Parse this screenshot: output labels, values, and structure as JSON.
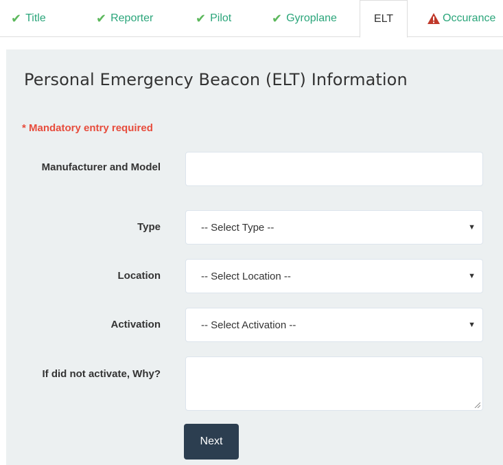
{
  "tabs": [
    {
      "label": "Title",
      "status": "done"
    },
    {
      "label": "Reporter",
      "status": "done"
    },
    {
      "label": "Pilot",
      "status": "done"
    },
    {
      "label": "Gyroplane",
      "status": "done"
    },
    {
      "label": "ELT",
      "status": "active"
    },
    {
      "label": "Occurance",
      "status": "error"
    }
  ],
  "form": {
    "heading": "Personal Emergency Beacon (ELT) Information",
    "mandatory_note": "* Mandatory entry required",
    "manufacturer": {
      "label": "Manufacturer and Model",
      "value": ""
    },
    "type": {
      "label": "Type",
      "selected": "-- Select Type --"
    },
    "location": {
      "label": "Location",
      "selected": "-- Select Location --"
    },
    "activation": {
      "label": "Activation",
      "selected": "-- Select Activation --"
    },
    "why": {
      "label": "If did not activate, Why?",
      "value": ""
    },
    "next_label": "Next"
  },
  "colors": {
    "tab_text": "#2aa57a",
    "check": "#5cb85c",
    "error_icon": "#c0392b",
    "mandatory": "#e74c3c",
    "panel_bg": "#ecf0f1",
    "button_bg": "#2c3e50"
  },
  "icons": {
    "done": "check-icon",
    "error": "warning-icon",
    "select": "caret-down-icon"
  }
}
